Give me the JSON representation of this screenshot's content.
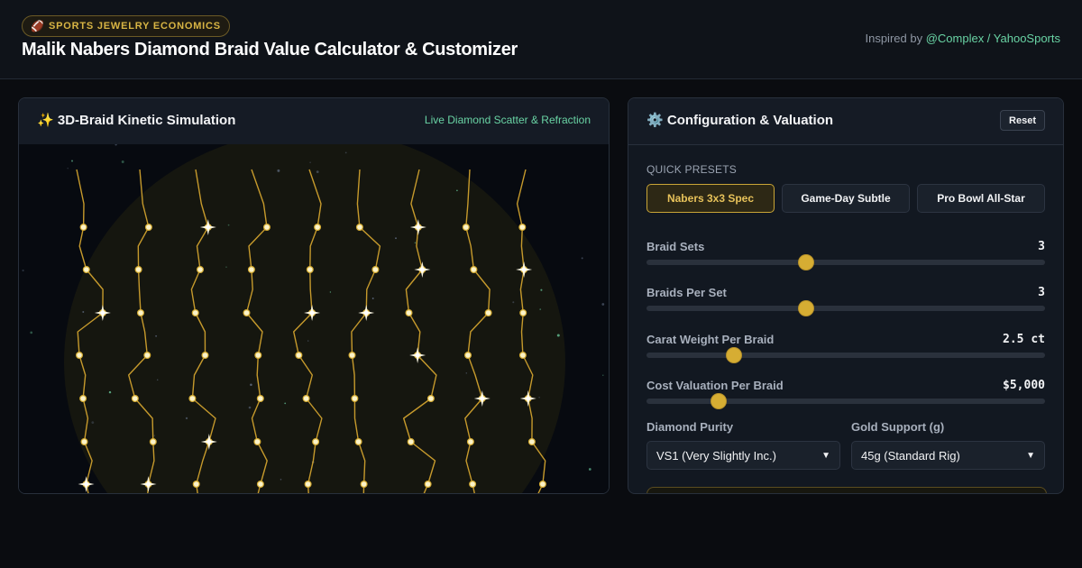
{
  "header": {
    "badge_icon": "football-icon",
    "badge_glyph": "🏈",
    "badge_text": "SPORTS JEWELRY ECONOMICS",
    "title": "Malik Nabers Diamond Braid Value Calculator & Customizer",
    "credit_prefix": "Inspired by",
    "credit_link": "@Complex / YahooSports"
  },
  "simulation": {
    "icon": "sparkles-icon",
    "icon_glyph": "✨",
    "title": "3D-Braid Kinetic Simulation",
    "subtitle": "Live Diamond Scatter & Refraction",
    "braid_count": 9,
    "stones_per_braid": 7
  },
  "config": {
    "icon": "gear-icon",
    "icon_glyph": "⚙️",
    "title": "Configuration & Valuation",
    "reset_label": "Reset",
    "presets_label": "QUICK PRESETS",
    "presets": [
      {
        "label": "Nabers 3x3 Spec",
        "active": true
      },
      {
        "label": "Game-Day Subtle",
        "active": false
      },
      {
        "label": "Pro Bowl All-Star",
        "active": false
      }
    ],
    "sliders": [
      {
        "label": "Braid Sets",
        "value": "3",
        "fraction": 0.4
      },
      {
        "label": "Braids Per Set",
        "value": "3",
        "fraction": 0.4
      },
      {
        "label": "Carat Weight Per Braid",
        "value": "2.5 ct",
        "fraction": 0.22
      },
      {
        "label": "Cost Valuation Per Braid",
        "value": "$5,000",
        "fraction": 0.18
      }
    ],
    "purity_label": "Diamond Purity",
    "purity_value": "VS1 (Very Slightly Inc.)",
    "gold_label": "Gold Support (g)",
    "gold_value": "45g (Standard Rig)"
  },
  "colors": {
    "accent_gold": "#d6ad33",
    "accent_green": "#69d3a4",
    "background": "#0a0c10"
  }
}
